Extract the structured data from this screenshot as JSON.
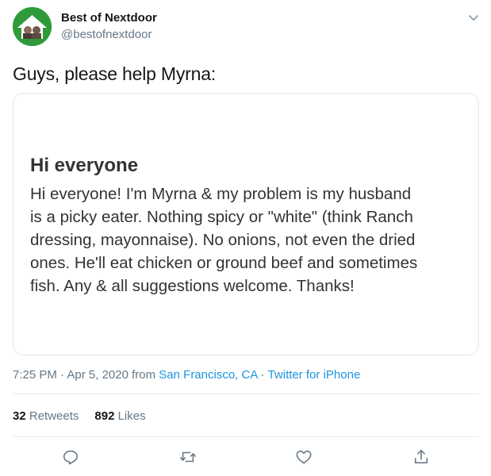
{
  "author": {
    "name": "Best of Nextdoor",
    "handle": "@bestofnextdoor",
    "avatar_icon": "nextdoor-house-avatar"
  },
  "tweet": {
    "text": "Guys, please help Myrna:"
  },
  "card": {
    "title": "Hi everyone",
    "lines": [
      "Hi everyone! I'm Myrna & my problem is my husband",
      "is a picky eater. Nothing spicy or \"white\" (think Ranch",
      "dressing, mayonnaise). No onions, not even the dried",
      "ones. He'll eat chicken or ground beef and sometimes",
      "fish. Any & all suggestions welcome. Thanks!"
    ]
  },
  "meta": {
    "time": "7:25 PM",
    "sep1": " · ",
    "date": "Apr 5, 2020",
    "from": " from ",
    "location": "San Francisco, CA",
    "sep2": " · ",
    "source": "Twitter for iPhone"
  },
  "stats": {
    "retweets_count": "32",
    "retweets_label": "Retweets",
    "likes_count": "892",
    "likes_label": "Likes"
  },
  "colors": {
    "link": "#1b95e0",
    "muted": "#657786",
    "text": "#14171a",
    "avatar_green": "#2f9a3a"
  },
  "icons": [
    "chevron-down-icon",
    "reply-icon",
    "retweet-icon",
    "like-icon",
    "share-icon"
  ]
}
